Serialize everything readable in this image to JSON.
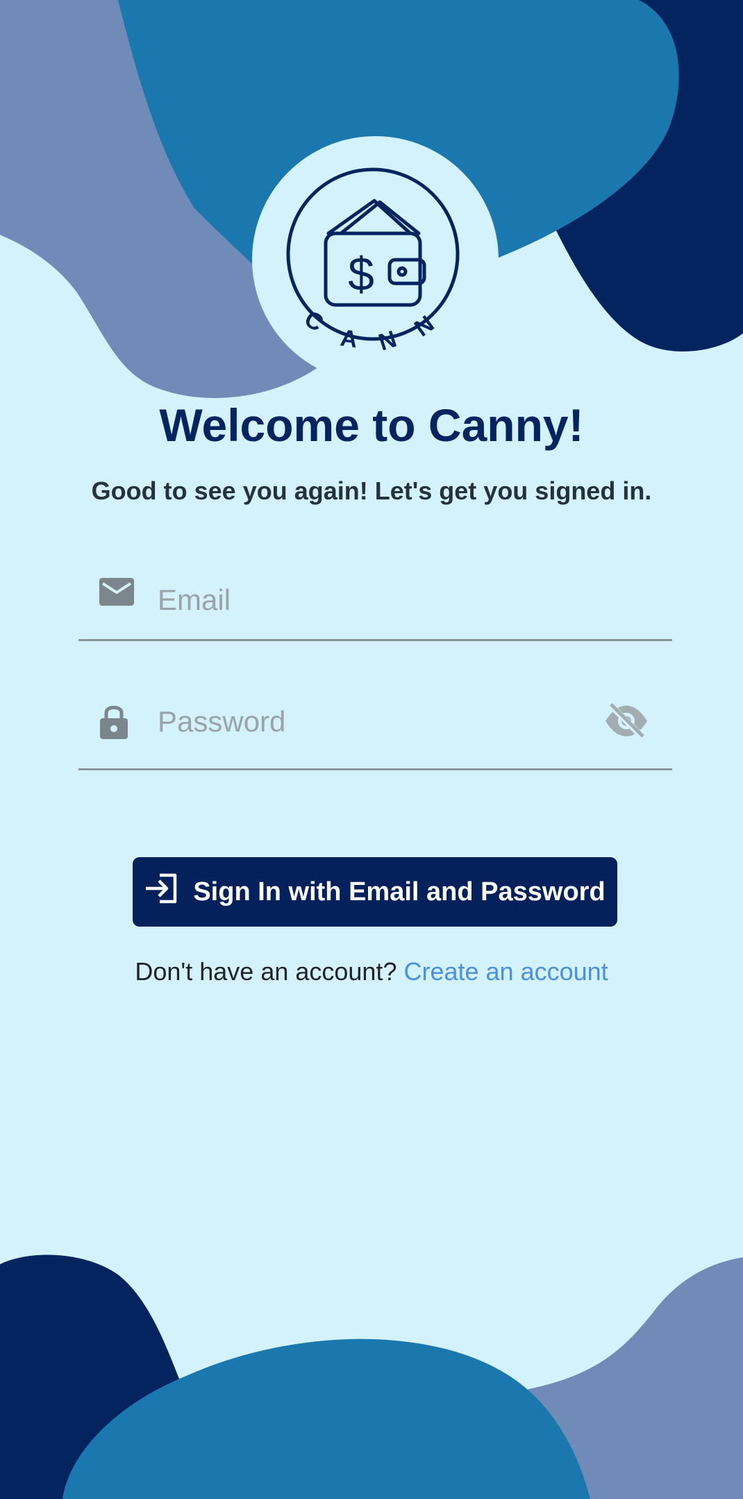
{
  "logo": {
    "wordmark": "CANNY",
    "currency_symbol": "$"
  },
  "header": {
    "title": "Welcome to Canny!",
    "subtitle": "Good to see you again! Let's get you signed in."
  },
  "form": {
    "email": {
      "placeholder": "Email",
      "value": ""
    },
    "password": {
      "placeholder": "Password",
      "value": ""
    },
    "submit_label": "Sign In with Email and Password"
  },
  "footer": {
    "prompt": "Don't have an account?",
    "link_label": "Create an account"
  },
  "colors": {
    "background": "#d4f2fc",
    "navy": "#04215c",
    "blue": "#1a78ae",
    "slate": "#708bb8",
    "link": "#4a90e2"
  },
  "icons": [
    "mail-icon",
    "lock-icon",
    "eye-off-icon",
    "login-icon",
    "wallet-icon"
  ]
}
